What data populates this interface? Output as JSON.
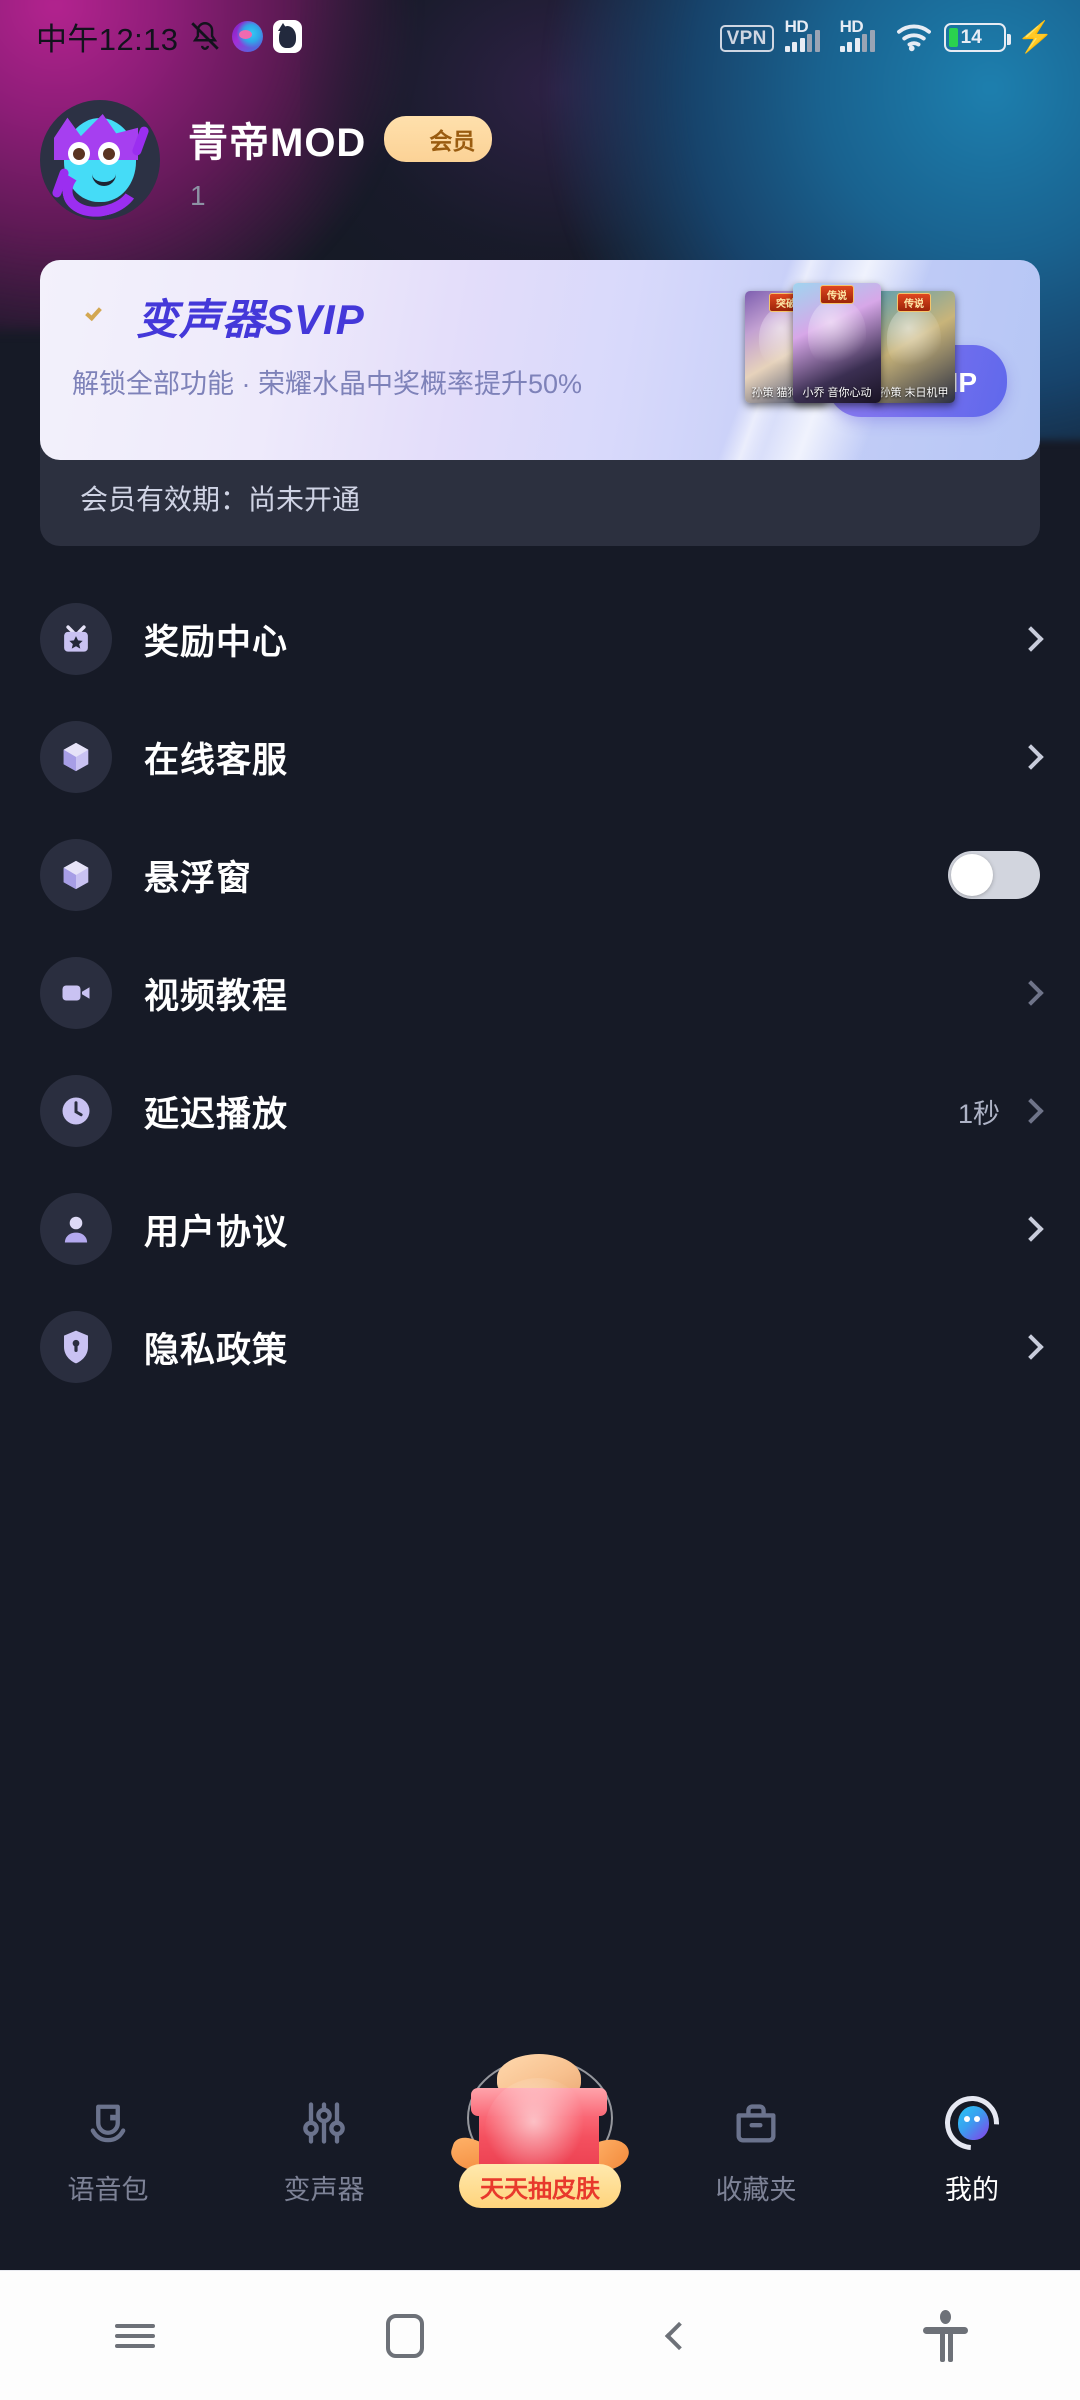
{
  "status_bar": {
    "time": "中午12:13",
    "mute_icon": "mute-bell-icon",
    "app_icon_1": "voice-app-icon",
    "app_icon_2": "cat-app-icon",
    "vpn_label": "VPN",
    "signal_1_label": "HD",
    "signal_2_label": "HD",
    "wifi_icon": "wifi-icon",
    "battery_percent": "14",
    "charging_icon": "charging-bolt-icon"
  },
  "profile": {
    "name": "青帝MOD",
    "vip_badge_label": "会员",
    "vip_badge_icon": "gem-check-icon",
    "user_id": "1",
    "avatar_icon": "mascot-avatar"
  },
  "skin_cards": [
    {
      "name": "孙策 猫狗日记",
      "tag": "突破"
    },
    {
      "name": "小乔 音你心动",
      "tag": "传说"
    },
    {
      "name": "孙策 末日机甲",
      "tag": "传说"
    }
  ],
  "banner": {
    "gem_icon": "diamond-outline-icon",
    "title": "变声器SVIP",
    "description": "解锁全部功能 · 荣耀水晶中奖概率提升50%",
    "button_label": "升级SVIP",
    "accent_color": "#4438d9",
    "button_color": "#7b72ee"
  },
  "validity": {
    "text": "会员有效期：尚未开通"
  },
  "menu": {
    "items": [
      {
        "label": "奖励中心",
        "icon": "gift-box-icon",
        "type": "link",
        "value": ""
      },
      {
        "label": "在线客服",
        "icon": "cube-box-icon",
        "type": "link",
        "value": ""
      },
      {
        "label": "悬浮窗",
        "icon": "cube-box-icon",
        "type": "toggle",
        "value": "off"
      },
      {
        "label": "视频教程",
        "icon": "video-camera-icon",
        "type": "link",
        "value": ""
      },
      {
        "label": "延迟播放",
        "icon": "clock-icon",
        "type": "link",
        "value": "1秒"
      },
      {
        "label": "用户协议",
        "icon": "person-icon",
        "type": "link",
        "value": ""
      },
      {
        "label": "隐私政策",
        "icon": "shield-lock-icon",
        "type": "link",
        "value": ""
      }
    ]
  },
  "tabs": [
    {
      "label": "语音包",
      "icon": "voice-pack-icon",
      "active": false
    },
    {
      "label": "变声器",
      "icon": "equalizer-icon",
      "active": false
    },
    {
      "label": "",
      "icon": "gift-draw-icon",
      "active": false,
      "ribbon": "天天抽皮肤"
    },
    {
      "label": "收藏夹",
      "icon": "folder-icon",
      "active": false
    },
    {
      "label": "我的",
      "icon": "profile-orb-icon",
      "active": true
    }
  ],
  "nav_bar": {
    "recents_icon": "recents-icon",
    "home_icon": "home-icon",
    "back_icon": "back-icon",
    "accessibility_icon": "accessibility-icon"
  }
}
